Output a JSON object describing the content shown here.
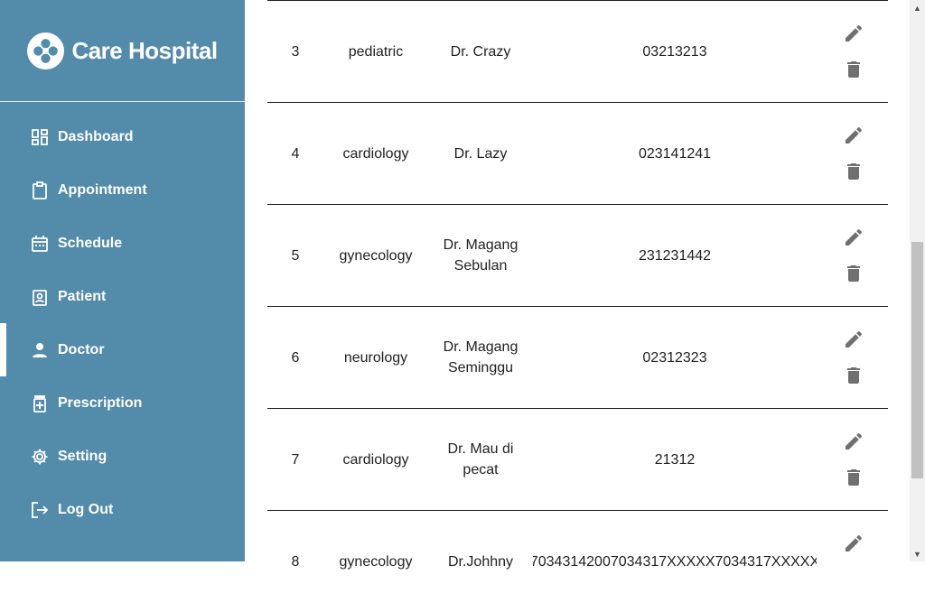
{
  "brand": {
    "name": "Care Hospital",
    "logo_icon": "plus-cross-logo-icon"
  },
  "colors": {
    "sidebar": "#538bab",
    "text": "#222222",
    "icon_gray": "#707070"
  },
  "nav": [
    {
      "label": "Dashboard",
      "icon": "dashboard-icon",
      "active": false
    },
    {
      "label": "Appointment",
      "icon": "clipboard-icon",
      "active": false
    },
    {
      "label": "Schedule",
      "icon": "calendar-icon",
      "active": false
    },
    {
      "label": "Patient",
      "icon": "patient-badge-icon",
      "active": false
    },
    {
      "label": "Doctor",
      "icon": "person-icon",
      "active": true
    },
    {
      "label": "Prescription",
      "icon": "prescription-bottle-icon",
      "active": false
    },
    {
      "label": "Setting",
      "icon": "gear-icon",
      "active": false
    },
    {
      "label": "Log Out",
      "icon": "logout-icon",
      "active": false
    }
  ],
  "doctors": [
    {
      "no": "3",
      "specialty": "pediatric",
      "name": "Dr. Crazy",
      "phone": "03213213"
    },
    {
      "no": "4",
      "specialty": "cardiology",
      "name": "Dr. Lazy",
      "phone": "023141241"
    },
    {
      "no": "5",
      "specialty": "gynecology",
      "name": "Dr. Magang Sebulan",
      "phone": "231231442"
    },
    {
      "no": "6",
      "specialty": "neurology",
      "name": "Dr. Magang Seminggu",
      "phone": "02312323"
    },
    {
      "no": "7",
      "specialty": "cardiology",
      "name": "Dr. Mau di pecat",
      "phone": "21312"
    },
    {
      "no": "8",
      "specialty": "gynecology",
      "name": "Dr.Johhny",
      "phone": "70343142007034317XXXXX7034317XXXXX"
    }
  ],
  "row_actions": {
    "edit_icon": "pencil-edit-icon",
    "delete_icon": "trash-delete-icon"
  }
}
